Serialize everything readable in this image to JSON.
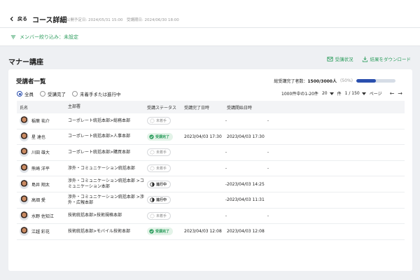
{
  "header": {
    "back_label": "戻る",
    "title": "コース詳細",
    "dates": "公開予定日: 2024/05/31 15:00　受講期日: 2024/06/30 18:00"
  },
  "filter": {
    "label": "メンバー絞り込み：未設定"
  },
  "section": {
    "title": "マナー講座",
    "actions": {
      "status": "受講状況",
      "download": "結果をダウンロード"
    }
  },
  "card": {
    "title": "受講者一覧",
    "progress_label": "総受講完了者数：",
    "progress_value": "1500/3000人",
    "progress_pct": "(50%)",
    "progress_fraction": 0.5,
    "radios": [
      "全員",
      "受講完了",
      "未着手または進行中"
    ],
    "selected_radio": 0,
    "pager": {
      "range": "1000件中の1-20件",
      "per_page": "20",
      "per_unit": "件",
      "page": "1 / 150",
      "page_unit": "ページ"
    },
    "columns": [
      "氏名",
      "主部署",
      "受講ステータス",
      "受講完了日時",
      "受講開始日時"
    ],
    "rows": [
      {
        "name": "稲葉 祐介",
        "dept": "コーポレート統括本部>総務本部",
        "status": "未着手",
        "status_type": "none",
        "completed": "-",
        "started": "-"
      },
      {
        "name": "星 達也",
        "dept": "コーポレート統括本部>人事本部",
        "status": "受講完了",
        "status_type": "done",
        "completed": "2023/04/03 17:30",
        "started": "2023/04/03 17:30"
      },
      {
        "name": "川田 雄大",
        "dept": "コーポレート統括本部>購買本部",
        "status": "未着手",
        "status_type": "none",
        "completed": "-",
        "started": "-"
      },
      {
        "name": "熊崎 洋平",
        "dept": "渉外・コミュニケーション統括本部",
        "status": "未着手",
        "status_type": "none",
        "completed": "-",
        "started": "-"
      },
      {
        "name": "島井 翔太",
        "dept": "渉外・コミュニケーション統括本部 >コミュニケーション本部",
        "status": "進行中",
        "status_type": "prog",
        "completed": "-",
        "started": "2023/04/03 14:25"
      },
      {
        "name": "高畑 愛",
        "dept": "渉外・コミュニケーション統括本部 >渉外・広報本部",
        "status": "進行中",
        "status_type": "prog",
        "completed": "-",
        "started": "2023/04/03 11:31"
      },
      {
        "name": "水野 佐知江",
        "dept": "技術統括本部>技術規格本部",
        "status": "未着手",
        "status_type": "none",
        "completed": "-",
        "started": "-"
      },
      {
        "name": "江越 彩花",
        "dept": "技術統括本部>モバイル技術本部",
        "status": "受講完了",
        "status_type": "done",
        "completed": "2023/04/03 12:08",
        "started": "2023/04/03 12:08"
      }
    ]
  },
  "colors": {
    "accent_green": "#2f9e5f",
    "progress_blue": "#2a4fae"
  }
}
